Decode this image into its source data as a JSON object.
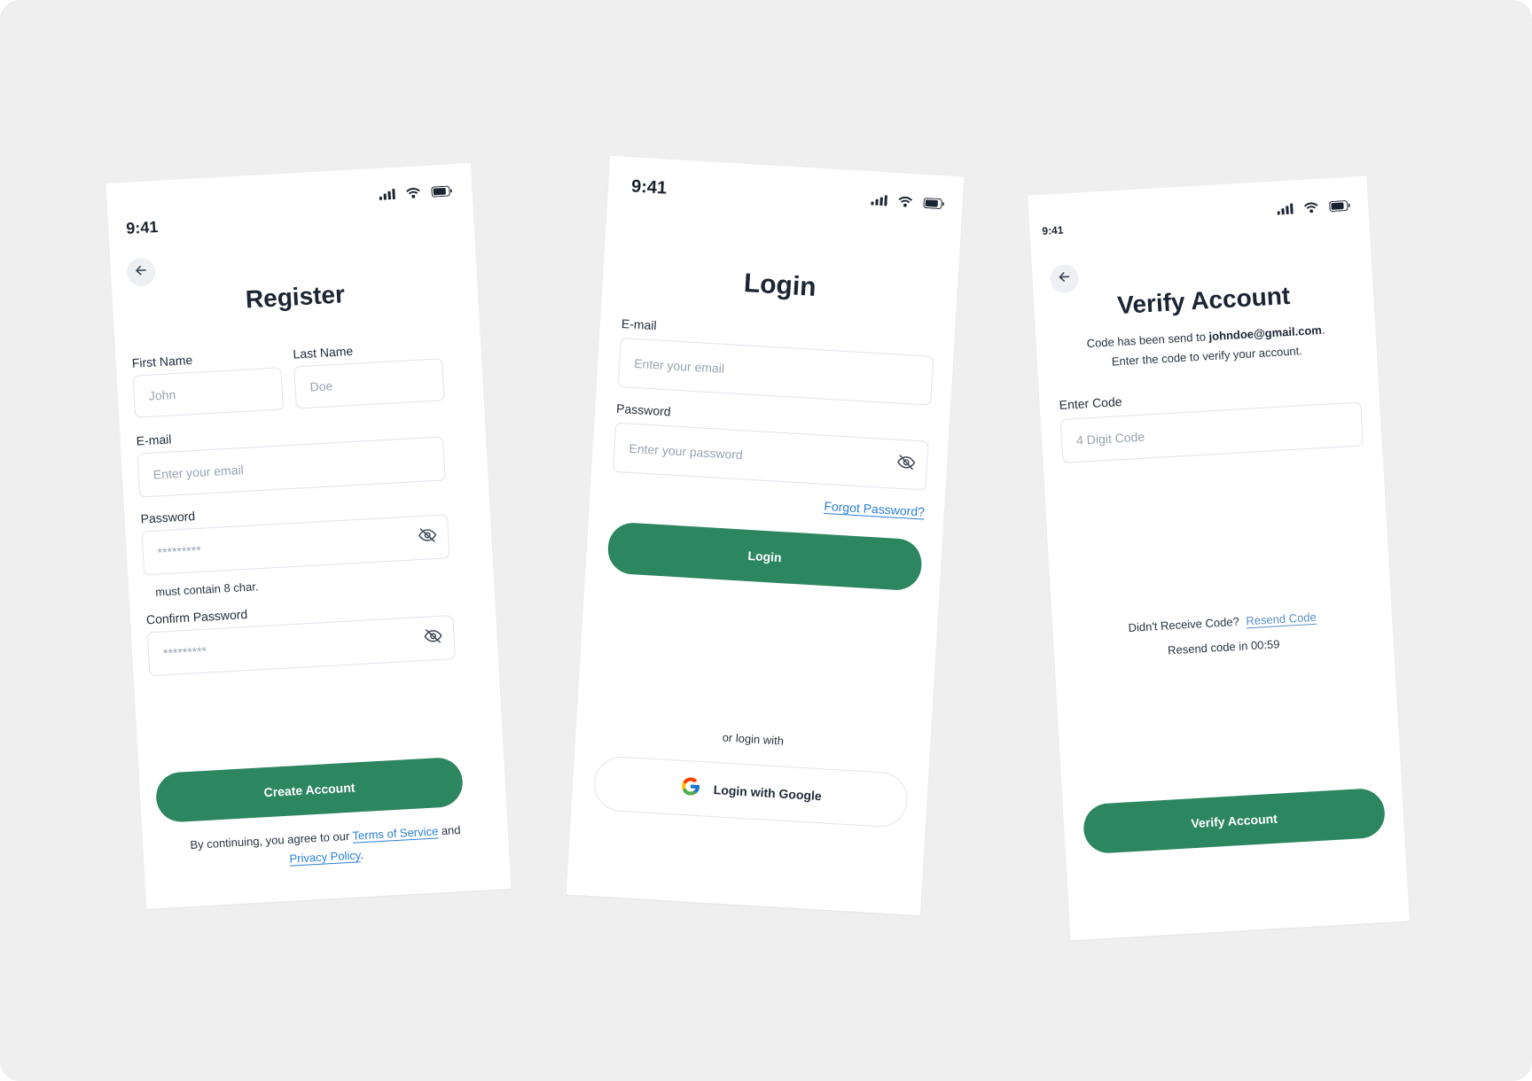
{
  "status_bar": {
    "time": "9:41"
  },
  "register": {
    "title": "Register",
    "first_name": {
      "label": "First Name",
      "placeholder": "John"
    },
    "last_name": {
      "label": "Last Name",
      "placeholder": "Doe"
    },
    "email": {
      "label": "E-mail",
      "placeholder": "Enter your email"
    },
    "password": {
      "label": "Password",
      "placeholder": "*********",
      "hint": "must contain 8 char."
    },
    "confirm_password": {
      "label": "Confirm Password",
      "placeholder": "*********"
    },
    "create_button": "Create Account",
    "legal": {
      "prefix": "By continuing, you agree to our",
      "terms": "Terms of Service",
      "and": "and",
      "privacy": "Privacy Policy",
      "suffix": "."
    }
  },
  "login": {
    "title": "Login",
    "email": {
      "label": "E-mail",
      "placeholder": "Enter your email"
    },
    "password": {
      "label": "Password",
      "placeholder": "Enter your password"
    },
    "forgot": "Forgot Password?",
    "login_button": "Login",
    "or_text": "or login with",
    "google_button": "Login with Google"
  },
  "verify": {
    "title": "Verify Account",
    "description_prefix": "Code has been send to",
    "email": "johndoe@gmail.com",
    "description_suffix": ".",
    "description_line2": "Enter the code to verify your account.",
    "code": {
      "label": "Enter Code",
      "placeholder": "4 Digit Code"
    },
    "didnt_receive": "Didn't Receive Code?",
    "resend": "Resend Code",
    "resend_timer": "Resend code in 00:59",
    "verify_button": "Verify Account"
  },
  "colors": {
    "primary": "#2c8660",
    "link": "#2b7fd6",
    "text": "#1b2533",
    "placeholder": "#9aa3b0",
    "background": "#efefef"
  }
}
